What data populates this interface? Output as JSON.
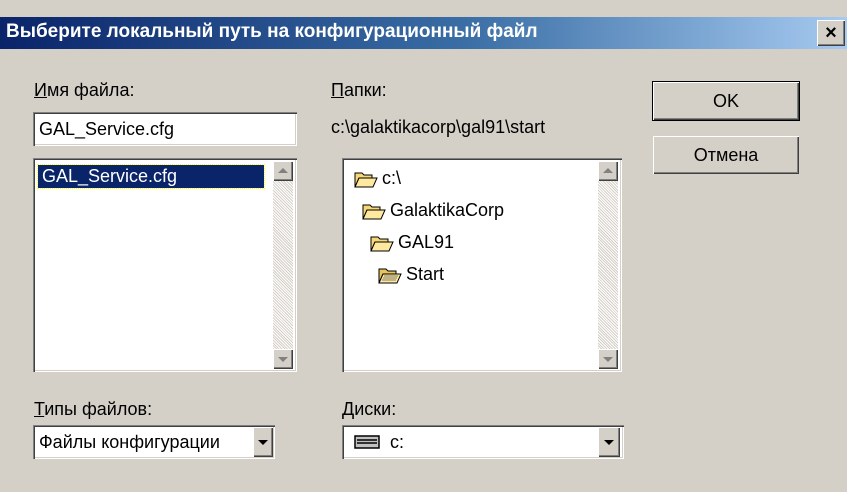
{
  "window": {
    "title": "Выберите локальный путь на конфигурационный файл",
    "close_label": "×"
  },
  "filename": {
    "label_access": "И",
    "label_rest": "мя файла:",
    "value": "GAL_Service.cfg",
    "files": [
      "GAL_Service.cfg"
    ]
  },
  "folders": {
    "label_access": "П",
    "label_rest": "апки:",
    "current_path": "c:\\galaktikacorp\\gal91\\start",
    "tree": [
      {
        "label": "c:\\",
        "state": "open"
      },
      {
        "label": "GalaktikaCorp",
        "state": "open"
      },
      {
        "label": "GAL91",
        "state": "open"
      },
      {
        "label": "Start",
        "state": "current"
      }
    ]
  },
  "buttons": {
    "ok": "OK",
    "cancel": "Отмена"
  },
  "file_types": {
    "label_access": "Т",
    "label_rest": "ипы файлов:",
    "selected": "Файлы конфигурации"
  },
  "drives": {
    "label_access": "Д",
    "label_rest": "иски:",
    "selected": "c:",
    "icon": "drive-icon"
  },
  "colors": {
    "title_gradient_start": "#0a246a",
    "title_gradient_end": "#a6caf0",
    "selection": "#0a246a",
    "face": "#d4d0c8"
  }
}
